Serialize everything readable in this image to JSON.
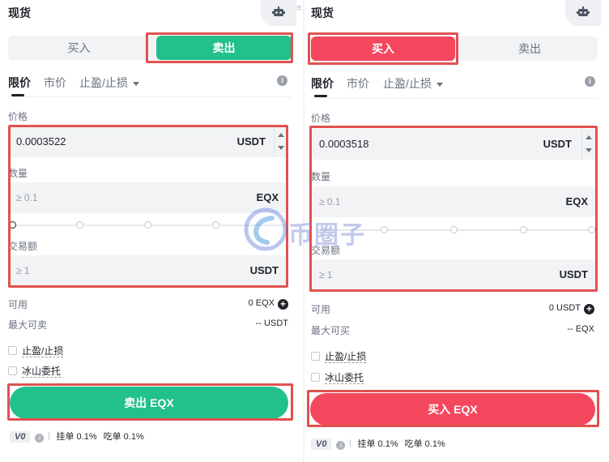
{
  "left": {
    "title": "现货",
    "side_tabs": {
      "buy": "买入",
      "sell": "卖出"
    },
    "order_tabs": {
      "limit": "限价",
      "market": "市价",
      "tpsl": "止盈/止损"
    },
    "price": {
      "label": "价格",
      "value": "0.0003522",
      "unit": "USDT"
    },
    "amount": {
      "label": "数量",
      "placeholder": "≥ 0.1",
      "unit": "EQX"
    },
    "total": {
      "label": "交易额",
      "placeholder": "≥ 1",
      "unit": "USDT"
    },
    "available": {
      "label": "可用",
      "value": "0 EQX"
    },
    "max": {
      "label": "最大可卖",
      "value": "-- USDT"
    },
    "tpsl_check": "止盈/止损",
    "iceberg_check": "冰山委托",
    "action": "卖出 EQX",
    "fee": {
      "level": "V0",
      "maker": "挂单 0.1%",
      "taker": "吃单 0.1%"
    }
  },
  "right": {
    "title": "现货",
    "side_tabs": {
      "buy": "买入",
      "sell": "卖出"
    },
    "order_tabs": {
      "limit": "限价",
      "market": "市价",
      "tpsl": "止盈/止损"
    },
    "price": {
      "label": "价格",
      "value": "0.0003518",
      "unit": "USDT"
    },
    "amount": {
      "label": "数量",
      "placeholder": "≥ 0.1",
      "unit": "EQX"
    },
    "total": {
      "label": "交易额",
      "placeholder": "≥ 1",
      "unit": "USDT"
    },
    "available": {
      "label": "可用",
      "value": "0 USDT"
    },
    "max": {
      "label": "最大可买",
      "value": "-- EQX"
    },
    "tpsl_check": "止盈/止损",
    "iceberg_check": "冰山委托",
    "action": "买入 EQX",
    "fee": {
      "level": "V0",
      "maker": "挂单 0.1%",
      "taker": "吃单 0.1%"
    }
  },
  "watermark": {
    "text": "币圈子"
  },
  "colors": {
    "sell": "#22c08a",
    "buy": "#f5475e",
    "highlight": "#e0524f"
  },
  "icons": {
    "robot": "robot-icon",
    "info": "info-icon",
    "plus": "plus-circle-icon"
  }
}
